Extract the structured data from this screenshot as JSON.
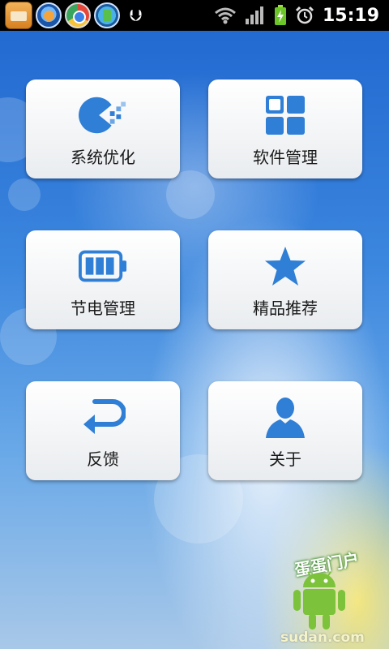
{
  "status_bar": {
    "time": "15:19",
    "notifications": [
      "folder-app-icon",
      "qq-app-icon",
      "browser-app-icon",
      "manager-app-icon",
      "usb-icon"
    ],
    "indicators": [
      "wifi-icon",
      "signal-icon",
      "battery-charging-icon",
      "alarm-icon"
    ]
  },
  "tiles": [
    {
      "label": "系统优化",
      "icon": "system-optimize-icon"
    },
    {
      "label": "软件管理",
      "icon": "grid-apps-icon"
    },
    {
      "label": "节电管理",
      "icon": "battery-icon"
    },
    {
      "label": "精品推荐",
      "icon": "star-icon"
    },
    {
      "label": "反馈",
      "icon": "return-arrow-icon"
    },
    {
      "label": "关于",
      "icon": "person-icon"
    }
  ],
  "watermark": {
    "text": "蛋蛋门户",
    "url": "sudan.com"
  },
  "colors": {
    "accent": "#2f7fd6",
    "tile_bg": "#f4f5f7",
    "status_bar": "#000000"
  }
}
